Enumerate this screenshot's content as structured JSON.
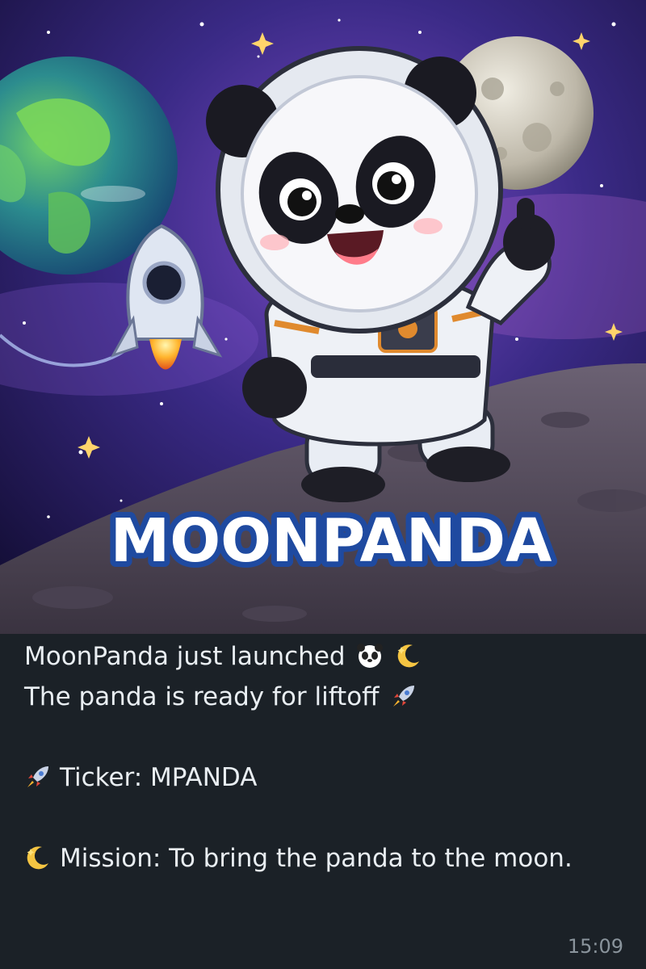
{
  "post": {
    "image": {
      "logo_text": "MOONPANDA",
      "description_icons": [
        "panda-astronaut",
        "earth",
        "moon",
        "rocket"
      ]
    },
    "caption": {
      "line1": "MoonPanda just launched",
      "line2": "The panda is ready for liftoff",
      "ticker": "Ticker: MPANDA",
      "mission": "Mission: To bring the panda to the moon."
    },
    "emojis": {
      "line1": [
        "panda-face-icon",
        "crescent-moon-icon"
      ],
      "line2": [
        "rocket-icon"
      ],
      "ticker": [
        "rocket-icon"
      ],
      "mission": [
        "crescent-moon-icon"
      ]
    },
    "timestamp": "15:09"
  },
  "colors": {
    "bubble_bg": "#1b2127",
    "text": "#e9eef2",
    "time": "#8a949c",
    "space_dark": "#1a1440",
    "space_purple": "#5b3aa6",
    "logo_fill": "#ffffff",
    "logo_outline": "#1f4aa0"
  }
}
